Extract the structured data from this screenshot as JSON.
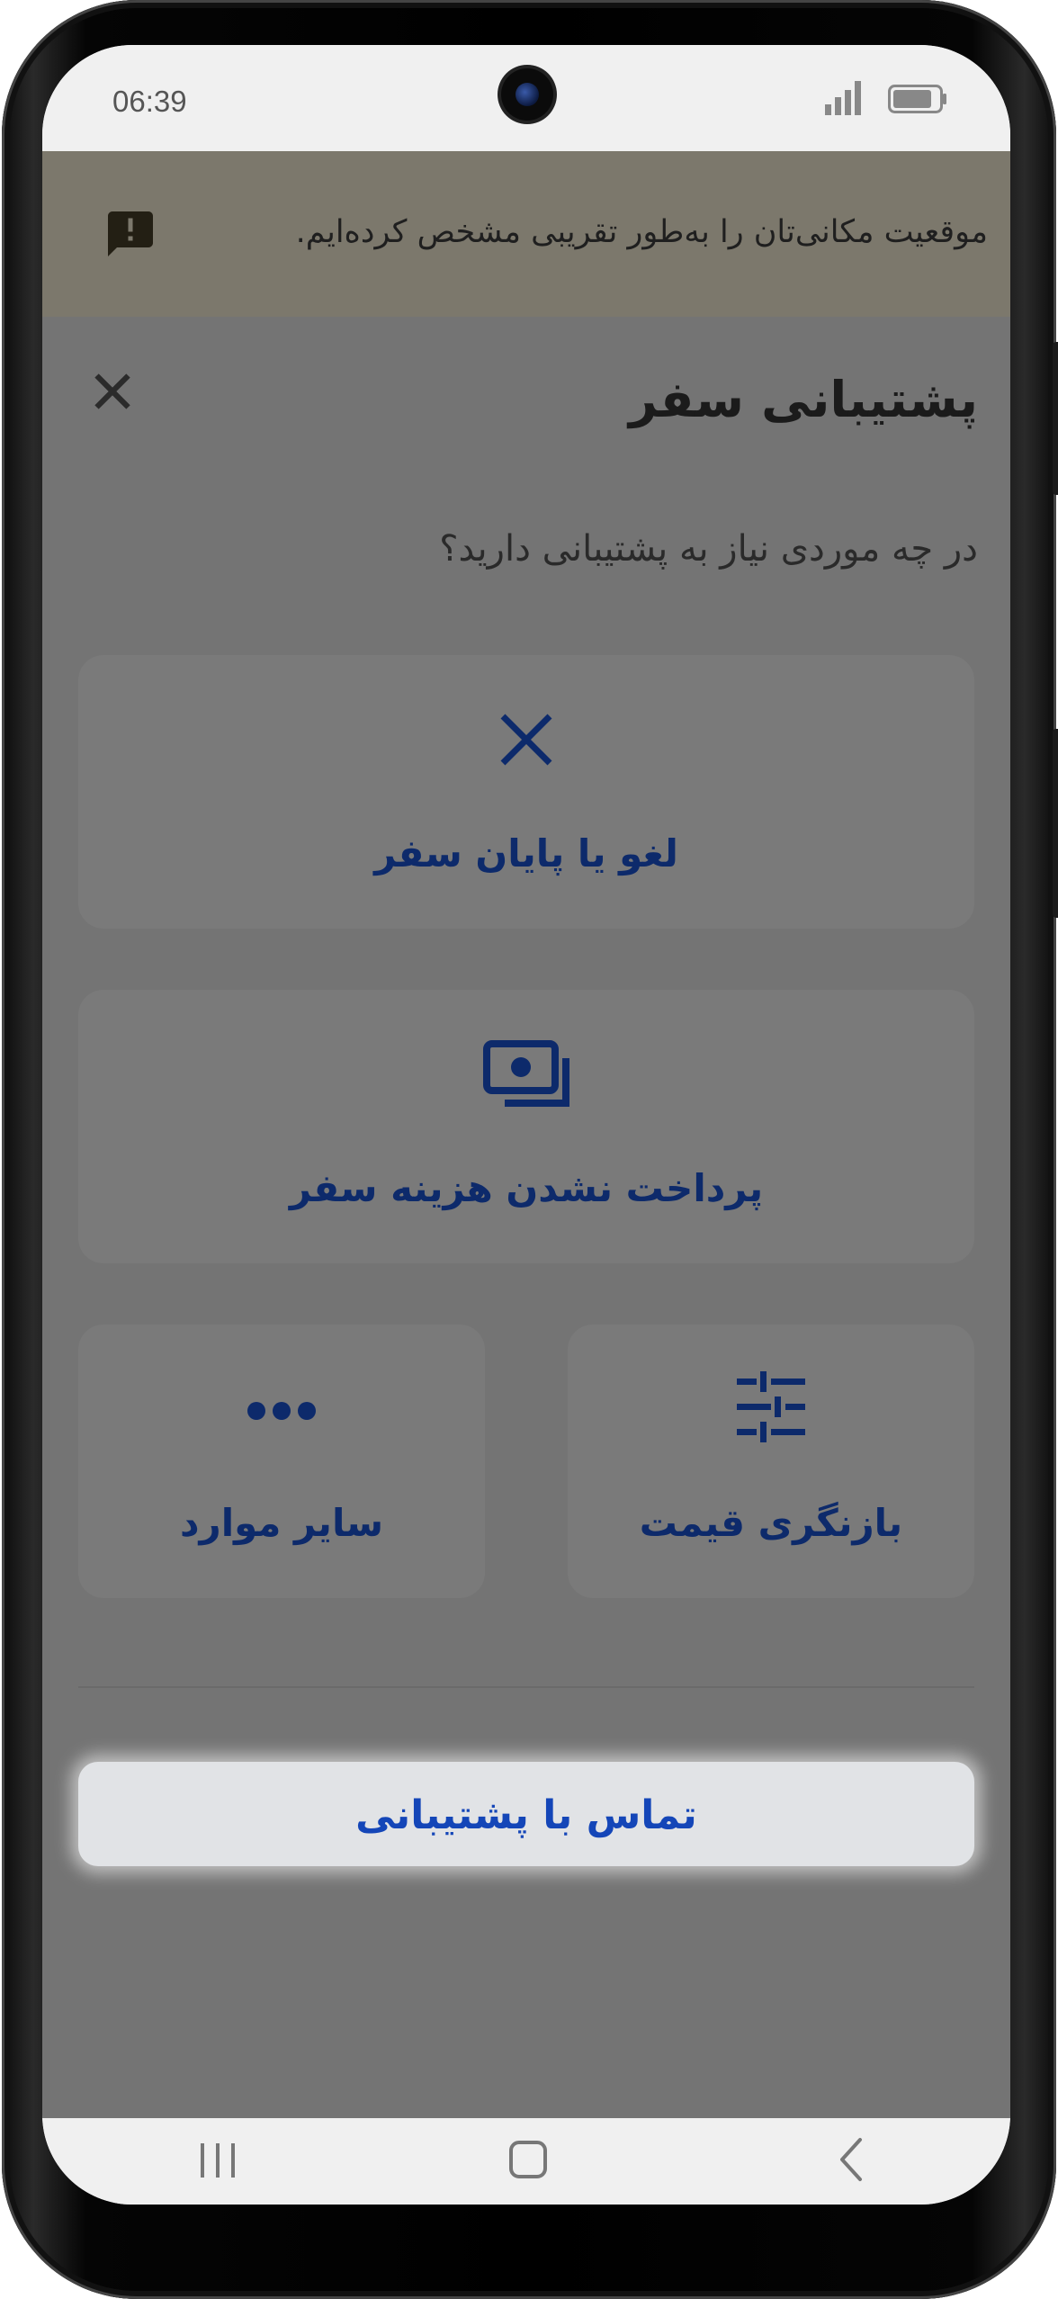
{
  "status_bar": {
    "time": "06:39"
  },
  "banner": {
    "text": "موقعیت مکانی‌تان را به‌طور تقریبی مشخص کرده‌ایم.",
    "icon": "feedback-alert-icon"
  },
  "sheet": {
    "title": "پشتیبانی سفر",
    "question": "در چه موردی نیاز به پشتیبانی دارید؟",
    "close_icon": "close-icon",
    "options": [
      {
        "label": "لغو یا پایان سفر",
        "icon": "cancel-x-icon"
      },
      {
        "label": "پرداخت نشدن هزینه سفر",
        "icon": "payment-cash-icon"
      },
      {
        "label": "بازنگری قیمت",
        "icon": "sliders-tune-icon"
      },
      {
        "label": "سایر موارد",
        "icon": "more-dots-icon"
      }
    ],
    "contact_button": "تماس با پشتیبانی"
  },
  "colors": {
    "accent": "#1446b8",
    "option_text": "#0d2a6b",
    "banner_bg": "#7c786c",
    "overlay_bg": "#747474"
  },
  "nav_bar": {
    "items": [
      "recent-apps-icon",
      "home-icon",
      "back-icon"
    ]
  }
}
